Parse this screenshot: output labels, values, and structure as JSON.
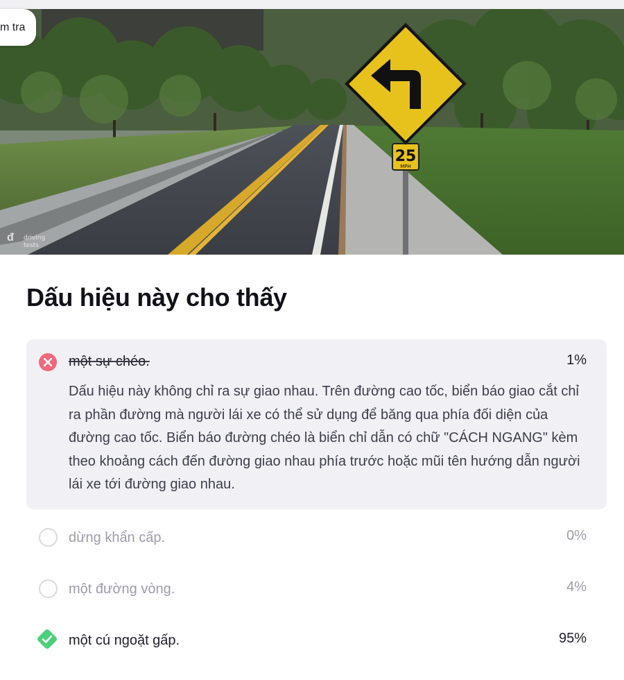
{
  "tag": {
    "label": "m tra"
  },
  "scene": {
    "sign_speed_number": "25",
    "sign_speed_unit": "MPH",
    "watermark_line1": "driving",
    "watermark_line2": "tests"
  },
  "question": {
    "text": "Dấu hiệu này cho thấy"
  },
  "answers": [
    {
      "label": "một sự chéo.",
      "percent": "1%",
      "state": "wrong",
      "explanation": "Dấu hiệu này không chỉ ra sự giao nhau. Trên đường cao tốc, biển báo giao cắt chỉ ra phần đường mà người lái xe có thể sử dụng để băng qua phía đối diện của đường cao tốc. Biển báo đường chéo là biển chỉ dẫn có chữ \"CÁCH NGANG\" kèm theo khoảng cách đến đường giao nhau phía trước hoặc mũi tên hướng dẫn người lái xe tới đường giao nhau."
    },
    {
      "label": "dừng khẩn cấp.",
      "percent": "0%",
      "state": "unselected"
    },
    {
      "label": "một đường vòng.",
      "percent": "4%",
      "state": "unselected"
    },
    {
      "label": "một cú ngoặt gấp.",
      "percent": "95%",
      "state": "correct"
    }
  ],
  "colors": {
    "wrong": "#f0697a",
    "correct": "#4cd07a",
    "muted_text": "#9c9ca8",
    "selected_bg": "#f1f1f5",
    "sign_yellow": "#e8c21c"
  },
  "icons": {
    "wrong": "close-circle-icon",
    "unselected": "empty-circle-icon",
    "correct": "check-diamond-icon"
  }
}
